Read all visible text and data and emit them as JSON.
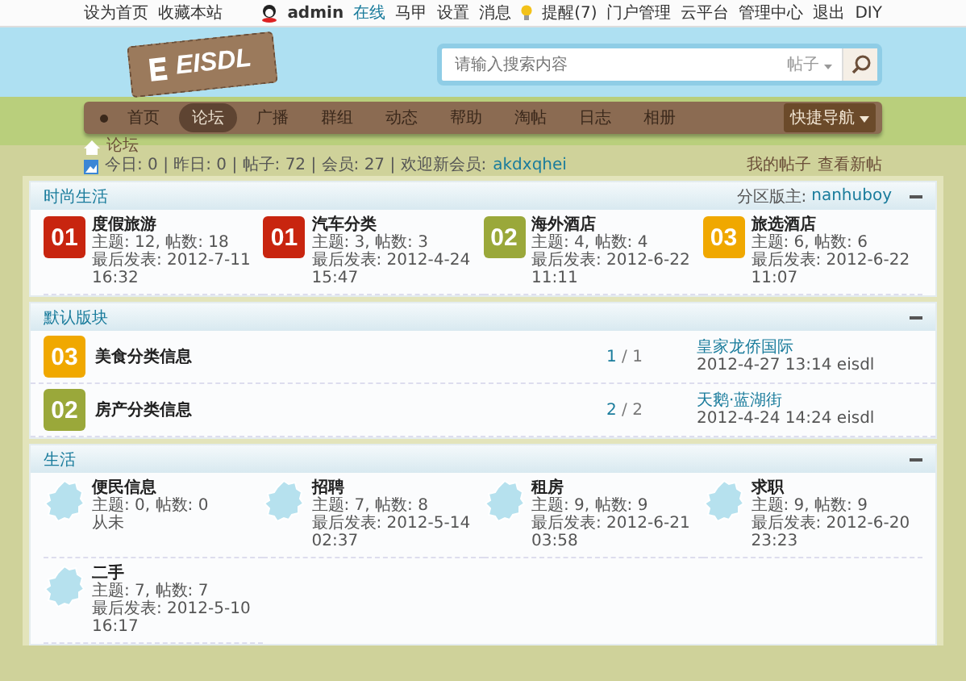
{
  "top_bar": {
    "left_links": [
      "设为首页",
      "收藏本站"
    ],
    "user": "admin",
    "status": "在线",
    "user_menu": "马甲",
    "links": [
      {
        "label": "设置",
        "kind": "plain"
      },
      {
        "label": "消息",
        "kind": "plain"
      },
      {
        "label": "提醒(7)",
        "kind": "bulb"
      },
      {
        "label": "门户管理",
        "kind": "plain"
      },
      {
        "label": "云平台",
        "kind": "plain"
      },
      {
        "label": "管理中心",
        "kind": "plain"
      },
      {
        "label": "退出",
        "kind": "plain"
      },
      {
        "label": "DIY",
        "kind": "plain"
      }
    ]
  },
  "logo": {
    "text": "EISDL"
  },
  "search": {
    "placeholder": "请输入搜索内容",
    "scope": "帖子"
  },
  "nav": {
    "items": [
      {
        "label": "首页",
        "selected": false
      },
      {
        "label": "论坛",
        "selected": true
      },
      {
        "label": "广播",
        "selected": false
      },
      {
        "label": "群组",
        "selected": false
      },
      {
        "label": "动态",
        "selected": false
      },
      {
        "label": "帮助",
        "selected": false
      },
      {
        "label": "淘帖",
        "selected": false
      },
      {
        "label": "日志",
        "selected": false
      },
      {
        "label": "相册",
        "selected": false
      }
    ],
    "quick_nav": "快捷导航"
  },
  "breadcrumb": "论坛",
  "stats": {
    "text": "今日: 0 | 昨日: 0 | 帖子: 72 | 会员: 27 | 欢迎新会员: ",
    "new_member": "akdxqhei",
    "links": [
      "我的帖子",
      "查看新帖"
    ]
  },
  "sections": [
    {
      "title": "时尚生活",
      "kind": "grid",
      "moderator_label": "分区版主:",
      "moderator": "nanhuboy",
      "forums": [
        {
          "name": "度假旅游",
          "badge": "01",
          "color": "#c8250f",
          "counts": "主题: 12, 帖数: 18",
          "last": "最后发表: 2012-7-11 16:32"
        },
        {
          "name": "汽车分类",
          "badge": "01",
          "color": "#c8250f",
          "counts": "主题: 3, 帖数: 3",
          "last": "最后发表: 2012-4-24 15:47"
        },
        {
          "name": "海外酒店",
          "badge": "02",
          "color": "#9aa83a",
          "counts": "主题: 4, 帖数: 4",
          "last": "最后发表: 2012-6-22 11:11"
        },
        {
          "name": "旅选酒店",
          "badge": "03",
          "color": "#f0a800",
          "counts": "主题: 6, 帖数: 6",
          "last": "最后发表: 2012-6-22 11:07"
        }
      ]
    },
    {
      "title": "默认版块",
      "kind": "list",
      "forums": [
        {
          "name": "美食分类信息",
          "badge": "03",
          "color": "#f0a800",
          "today": "1",
          "total": "/ 1",
          "last_thread": "皇家龙侨国际",
          "last": "2012-4-27 13:14 eisdl"
        },
        {
          "name": "房产分类信息",
          "badge": "02",
          "color": "#9aa83a",
          "today": "2",
          "total": "/ 2",
          "last_thread": "天鹅·蓝湖街",
          "last": "2012-4-24 14:24 eisdl"
        }
      ]
    },
    {
      "title": "生活",
      "kind": "grid",
      "forums": [
        {
          "name": "便民信息",
          "counts": "主题: 0, 帖数: 0",
          "last": "从未"
        },
        {
          "name": "招聘",
          "counts": "主题: 7, 帖数: 8",
          "last": "最后发表: 2012-5-14 02:37"
        },
        {
          "name": "租房",
          "counts": "主题: 9, 帖数: 9",
          "last": "最后发表: 2012-6-21 03:58"
        },
        {
          "name": "求职",
          "counts": "主题: 9, 帖数: 9",
          "last": "最后发表: 2012-6-20 23:23"
        },
        {
          "name": "二手",
          "counts": "主题: 7, 帖数: 7",
          "last": "最后发表: 2012-5-10 16:17"
        }
      ]
    }
  ]
}
